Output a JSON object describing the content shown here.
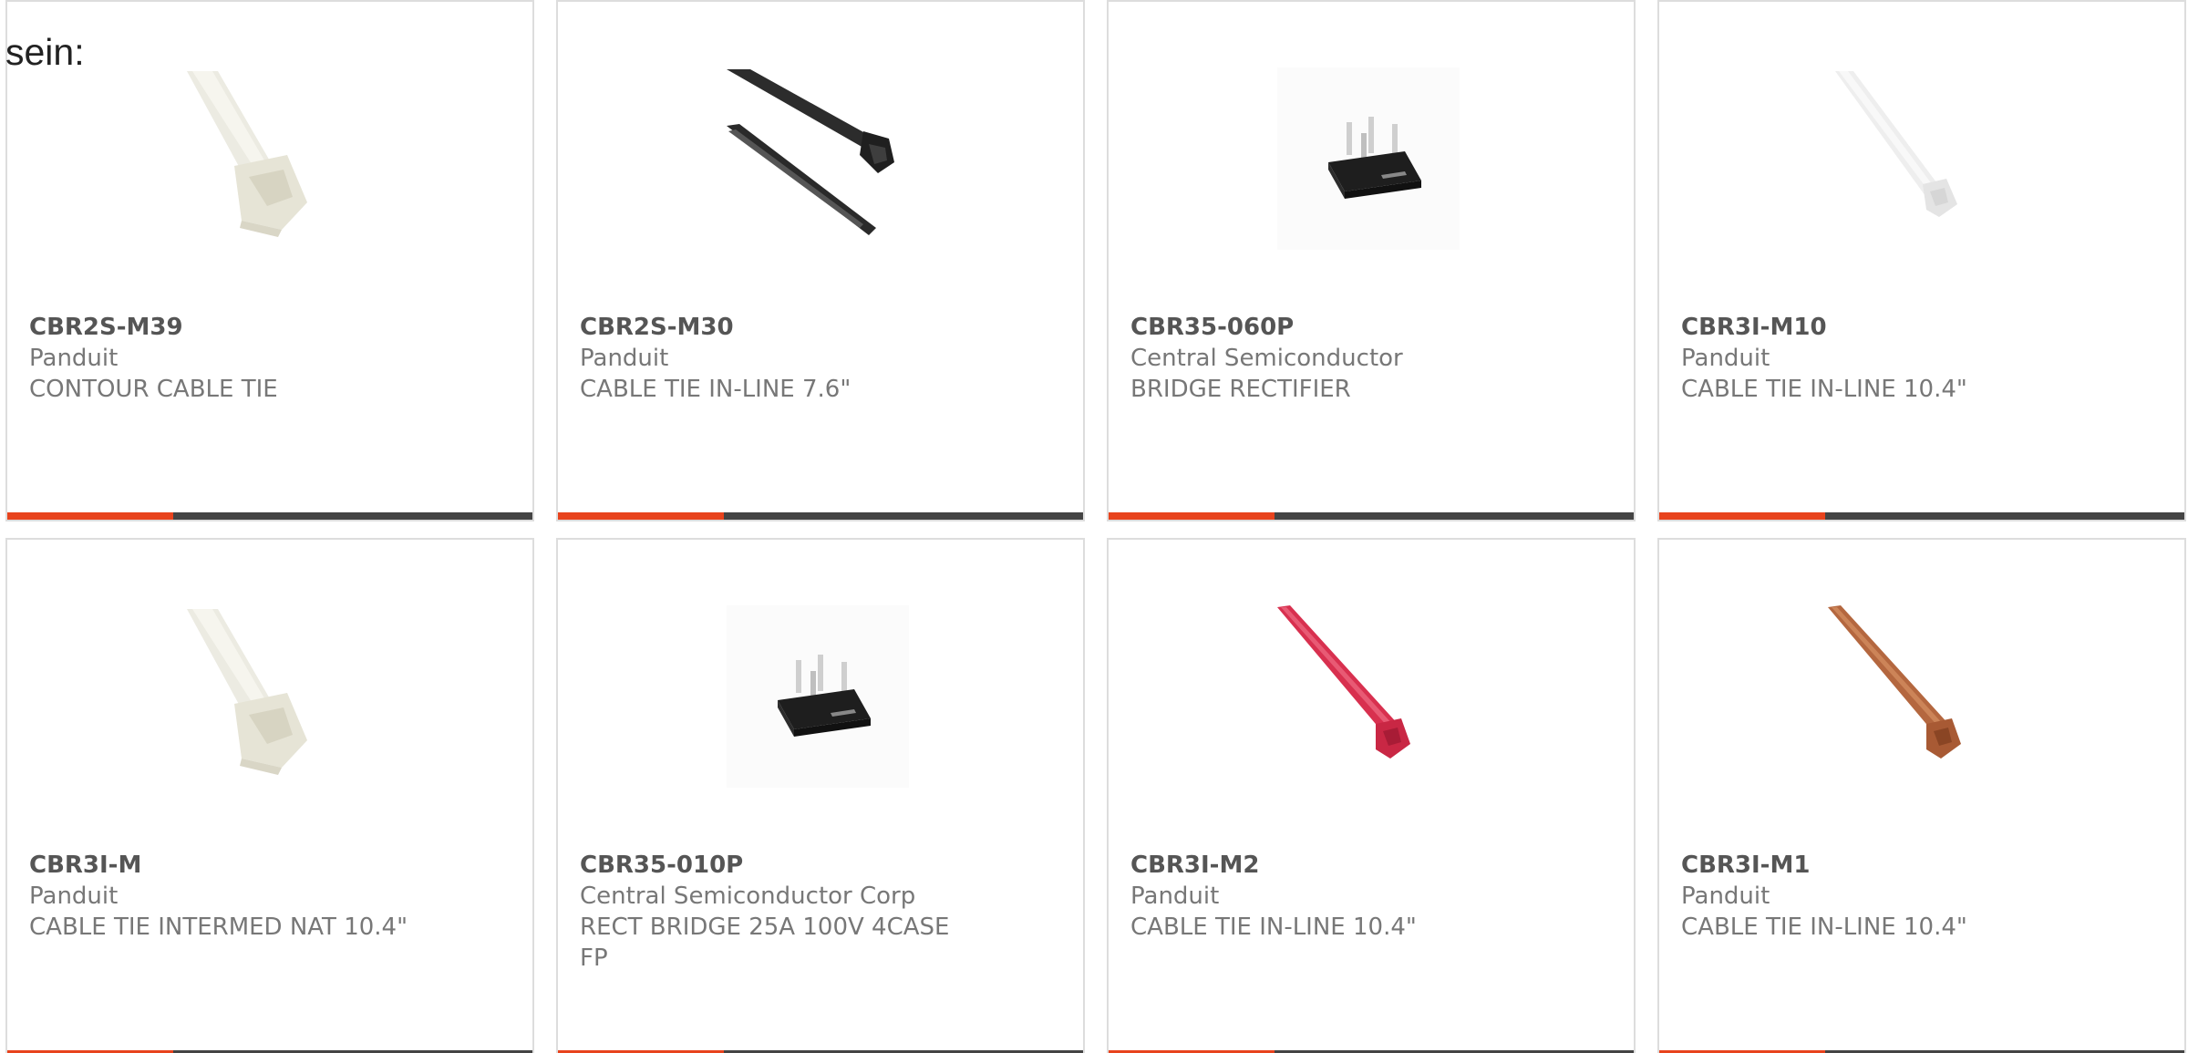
{
  "intro_text": "sein:",
  "colors": {
    "accent": "#e8431d",
    "bar": "#444444",
    "border": "#dddddd"
  },
  "products": [
    {
      "part": "CBR2S-M39",
      "manufacturer": "Panduit",
      "description": "CONTOUR CABLE TIE",
      "image": "white-cable-tie-head-icon"
    },
    {
      "part": "CBR2S-M30",
      "manufacturer": "Panduit",
      "description": "CABLE TIE IN-LINE 7.6\"",
      "image": "black-cable-tie-icon"
    },
    {
      "part": "CBR35-060P",
      "manufacturer": "Central Semiconductor",
      "description": "BRIDGE RECTIFIER",
      "image": "bridge-rectifier-icon"
    },
    {
      "part": "CBR3I-M10",
      "manufacturer": "Panduit",
      "description": "CABLE TIE IN-LINE 10.4\"",
      "image": "clear-cable-tie-icon"
    },
    {
      "part": "CBR3I-M",
      "manufacturer": "Panduit",
      "description": "CABLE TIE INTERMED NAT 10.4\"",
      "image": "white-cable-tie-head-icon"
    },
    {
      "part": "CBR35-010P",
      "manufacturer": "Central Semiconductor Corp",
      "description": "RECT BRIDGE 25A 100V 4CASE FP",
      "image": "bridge-rectifier-icon"
    },
    {
      "part": "CBR3I-M2",
      "manufacturer": "Panduit",
      "description": "CABLE TIE IN-LINE 10.4\"",
      "image": "red-cable-tie-icon"
    },
    {
      "part": "CBR3I-M1",
      "manufacturer": "Panduit",
      "description": "CABLE TIE IN-LINE 10.4\"",
      "image": "brown-cable-tie-icon"
    }
  ]
}
